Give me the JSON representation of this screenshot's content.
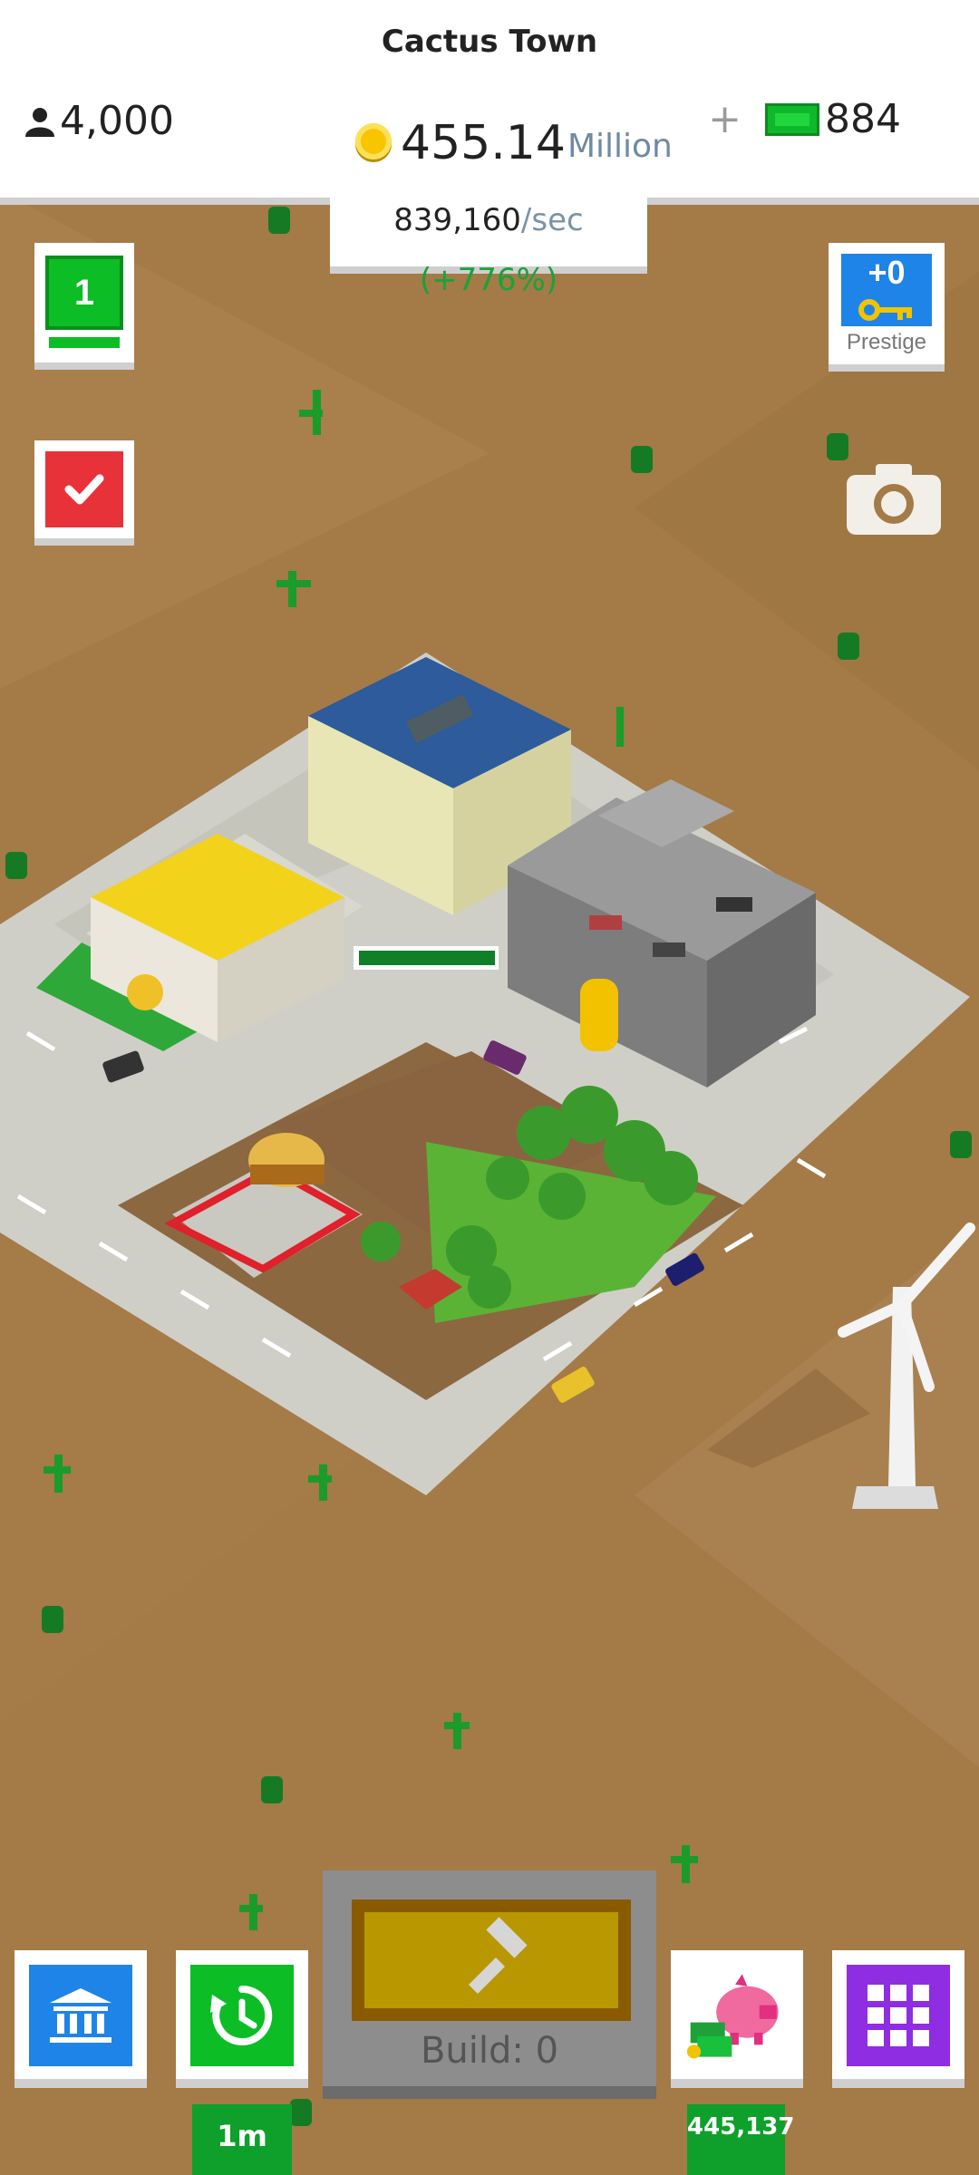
{
  "header": {
    "title": "Cactus Town",
    "population": "4,000",
    "coins_amount": "455.14",
    "coins_unit": "Million",
    "income_value": "839,160",
    "income_unit": "/sec",
    "income_bonus": "(+776%)",
    "cash_plus": "+",
    "cash_amount": "884"
  },
  "side": {
    "level": "1",
    "prestige_value": "+0",
    "prestige_label": "Prestige"
  },
  "bottom": {
    "build_label": "Build: 0",
    "time_boost_label": "1m",
    "piggy_bank_amount": "445,137"
  },
  "icons": {
    "population": "person-icon",
    "coin": "coin-icon",
    "cash": "banknote-icon",
    "task": "checkmark-icon",
    "prestige": "key-icon",
    "camera": "camera-icon",
    "bank": "bank-icon",
    "time": "clock-refresh-icon",
    "piggy": "piggy-bank-icon",
    "grid": "grid-menu-icon",
    "build": "hammer-icon"
  },
  "colors": {
    "desert": "#a47a47",
    "accent_green": "#0cbd26",
    "accent_blue": "#1f84e8",
    "accent_red": "#e8323a",
    "accent_pink": "#e0307f",
    "accent_purple": "#8e2de2"
  }
}
